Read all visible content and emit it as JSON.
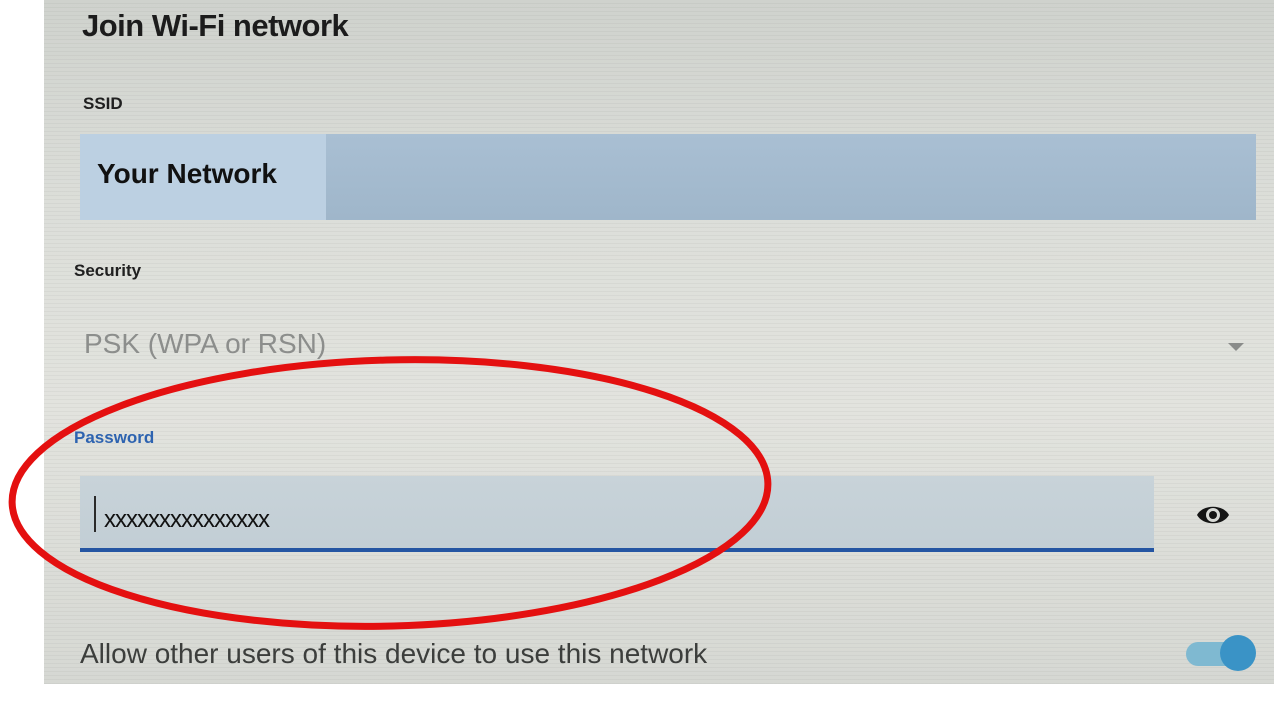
{
  "dialog": {
    "title": "Join Wi-Fi network"
  },
  "ssid": {
    "label": "SSID",
    "value": "Your Network"
  },
  "security": {
    "label": "Security",
    "selected": "PSK (WPA or RSN)"
  },
  "password": {
    "label": "Password",
    "value": "xxxxxxxxxxxxxxx",
    "visibility_icon": "eye-icon"
  },
  "allow_users": {
    "label": "Allow other users of this device to use this network",
    "enabled": true
  },
  "colors": {
    "accent": "#2455a2",
    "toggle": "#3a93c6",
    "annotation": "#e41010"
  }
}
